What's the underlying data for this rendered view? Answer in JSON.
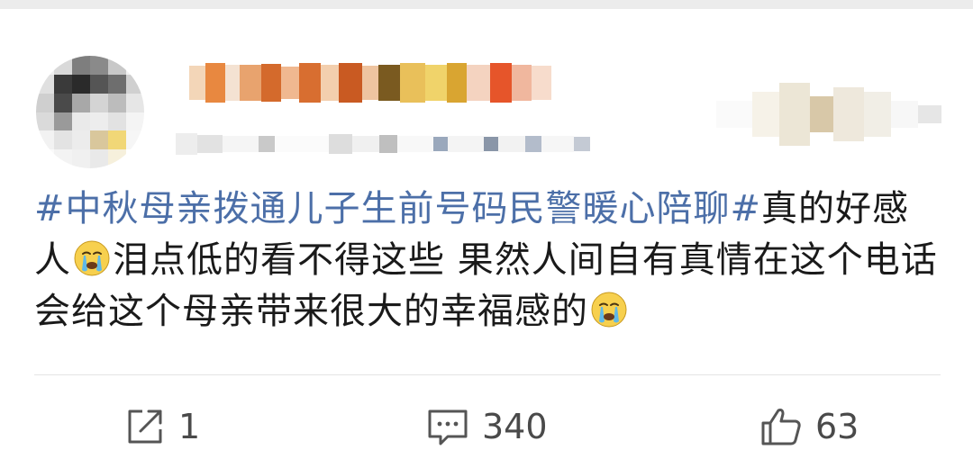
{
  "post": {
    "hashtag": "#中秋母亲拨通儿子生前号码民警暖心陪聊#",
    "text_part1": "真的好感人",
    "text_part2": "泪点低的看不得这些 果然人间自有真情在这个电话会给这个母亲带来很大的幸福感的",
    "emoji_name": "crying-face-icon"
  },
  "actions": {
    "repost_count": "1",
    "comment_count": "340",
    "like_count": "63",
    "repost_icon": "share-icon",
    "comment_icon": "comment-icon",
    "like_icon": "thumbs-up-icon"
  },
  "colors": {
    "hashtag": "#4c6fa8",
    "text": "#1a1a1a",
    "action_icon": "#555555",
    "divider": "#e4e4e4"
  }
}
